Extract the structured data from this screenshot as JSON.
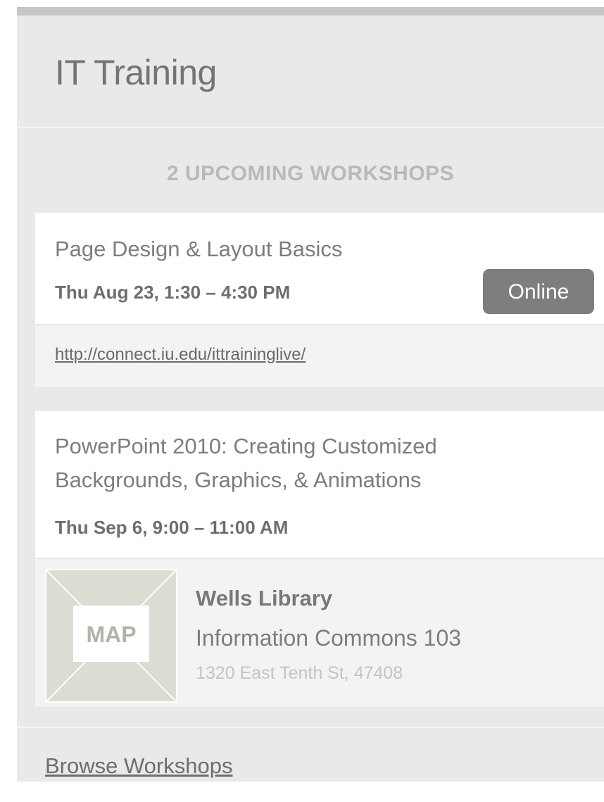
{
  "header": {
    "title": "IT Training"
  },
  "summary": {
    "count_label": "2 UPCOMING WORKSHOPS"
  },
  "workshops": [
    {
      "title": "Page Design & Layout Basics",
      "datetime": "Thu Aug 23, 1:30 – 4:30 PM",
      "badge": "Online",
      "url": "http://connect.iu.edu/ittraininglive/"
    },
    {
      "title_line1": "PowerPoint 2010: Creating Customized",
      "title_line2": "Backgrounds, Graphics, & Animations",
      "datetime": "Thu Sep 6, 9:00 – 11:00 AM",
      "map_label": "MAP",
      "location": {
        "building": "Wells Library",
        "room": "Information Commons 103",
        "address": "1320 East Tenth St, 47408"
      }
    }
  ],
  "footer": {
    "browse_label": "Browse Workshops"
  }
}
